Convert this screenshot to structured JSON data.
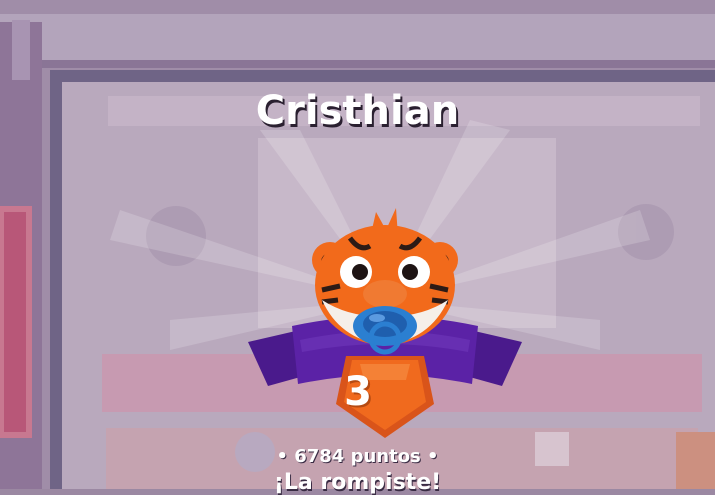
{
  "player": {
    "name": "Cristhian",
    "points": "• 6784 puntos •",
    "message": "¡La rompiste!",
    "rank": "3"
  },
  "avatar": {
    "icon": "tiger-with-pacifier-icon"
  },
  "colors": {
    "background": "#9b88a2",
    "ribbon": "#5a1fa0",
    "medal": "#f06a1e",
    "tiger": "#f26a1b",
    "pacifier": "#2b7fd1"
  }
}
